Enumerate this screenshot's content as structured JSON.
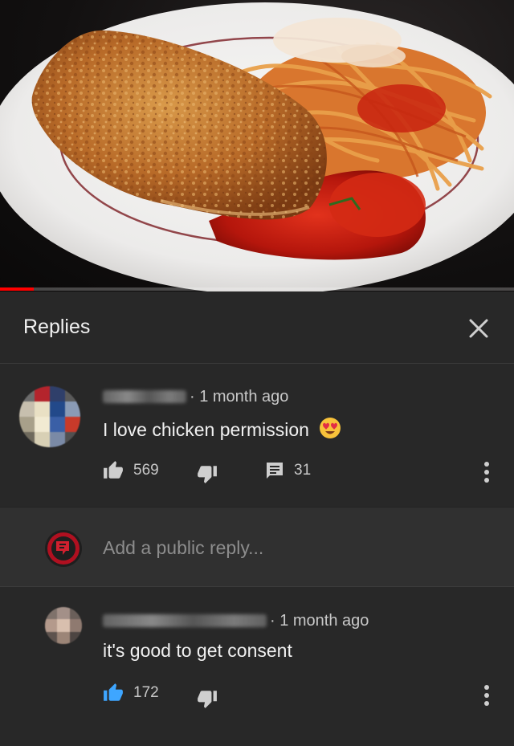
{
  "video": {
    "progress_fraction": 0.065,
    "progress_color": "#ff0000"
  },
  "replies_header": {
    "title": "Replies",
    "close_icon": "close-icon"
  },
  "comments": [
    {
      "meta": "· 1 month ago",
      "text": "I love chicken permission",
      "emoji": "😍",
      "likes": "569",
      "replies": "31",
      "like_active": false
    },
    {
      "meta": "· 1 month ago",
      "text": "it's good to get consent",
      "likes": "172",
      "like_active": true,
      "like_color": "#3ea6ff"
    }
  ],
  "reply_input": {
    "placeholder": "Add a public reply..."
  },
  "colors": {
    "background": "#282828",
    "reply_box": "#303030",
    "text_primary": "#f1f1f1",
    "text_secondary": "#c8c8c8"
  }
}
